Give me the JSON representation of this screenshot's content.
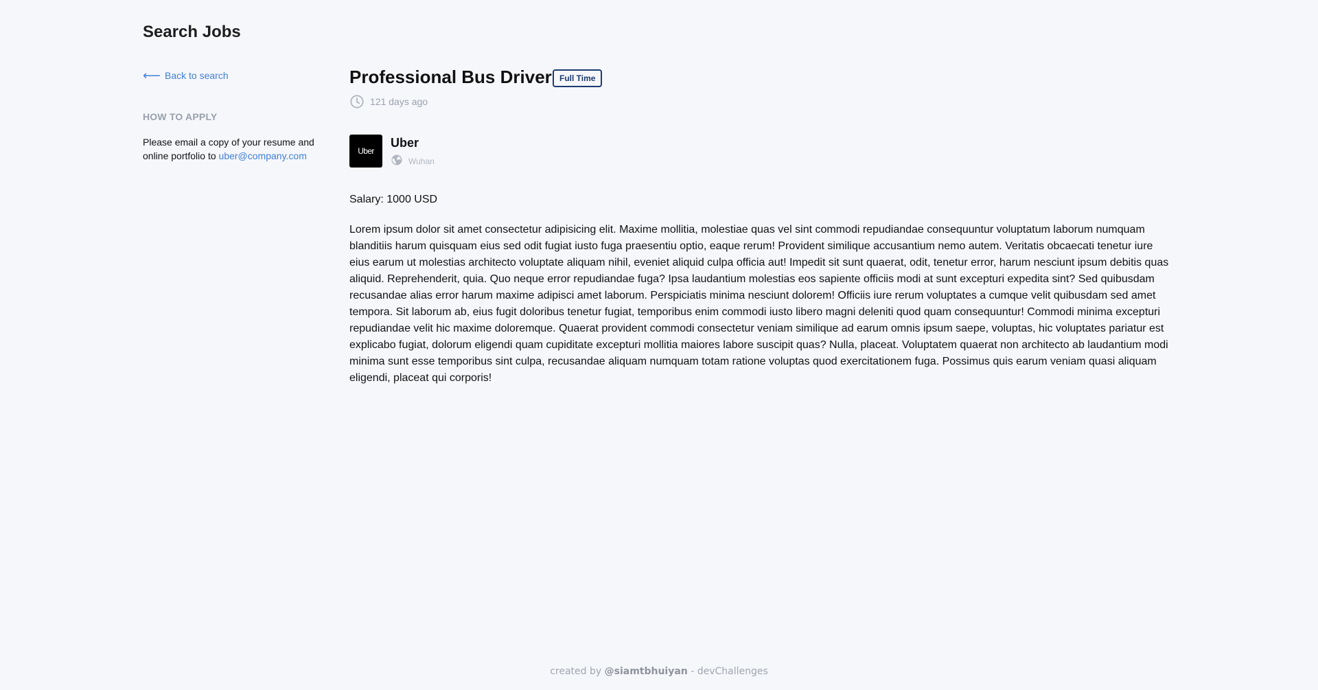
{
  "site": {
    "title": "Search Jobs"
  },
  "sidebar": {
    "back_label": "Back to search",
    "how_to_apply_heading": "HOW TO APPLY",
    "how_to_apply_text": "Please email a copy of your resume and online portfolio to ",
    "email": "uber@company.com"
  },
  "job": {
    "title": "Professional Bus Driver",
    "type_badge": "Full Time",
    "posted": "121 days ago",
    "company": {
      "logo_text": "Uber",
      "name": "Uber",
      "location": "Wuhan"
    },
    "salary": "Salary: 1000 USD",
    "description": "Lorem ipsum dolor sit amet consectetur adipisicing elit. Maxime mollitia, molestiae quas vel sint commodi repudiandae consequuntur voluptatum laborum numquam blanditiis harum quisquam eius sed odit fugiat iusto fuga praesentiu optio, eaque rerum! Provident similique accusantium nemo autem. Veritatis obcaecati tenetur iure eius earum ut molestias architecto voluptate aliquam nihil, eveniet aliquid culpa officia aut! Impedit sit sunt quaerat, odit, tenetur error, harum nesciunt ipsum debitis quas aliquid. Reprehenderit, quia. Quo neque error repudiandae fuga? Ipsa laudantium molestias eos sapiente officiis modi at sunt excepturi expedita sint? Sed quibusdam recusandae alias error harum maxime adipisci amet laborum. Perspiciatis minima nesciunt dolorem! Officiis iure rerum voluptates a cumque velit quibusdam sed amet tempora. Sit laborum ab, eius fugit doloribus tenetur fugiat, temporibus enim commodi iusto libero magni deleniti quod quam consequuntur! Commodi minima excepturi repudiandae velit hic maxime doloremque. Quaerat provident commodi consectetur veniam similique ad earum omnis ipsum saepe, voluptas, hic voluptates pariatur est explicabo fugiat, dolorum eligendi quam cupiditate excepturi mollitia maiores labore suscipit quas? Nulla, placeat. Voluptatem quaerat non architecto ab laudantium modi minima sunt esse temporibus sint culpa, recusandae aliquam numquam totam ratione voluptas quod exercitationem fuga. Possimus quis earum veniam quasi aliquam eligendi, placeat qui corporis!"
  },
  "footer": {
    "prefix": "created by ",
    "author": "@siamtbhuiyan",
    "suffix": " - devChallenges"
  },
  "icons": {
    "back": "arrow-left-icon",
    "posted": "clock-icon",
    "location": "globe-icon"
  },
  "colors": {
    "background": "#f6f7fb",
    "link": "#3f7fd9",
    "badge": "#1e3a6e",
    "muted": "#9aa1ad"
  }
}
